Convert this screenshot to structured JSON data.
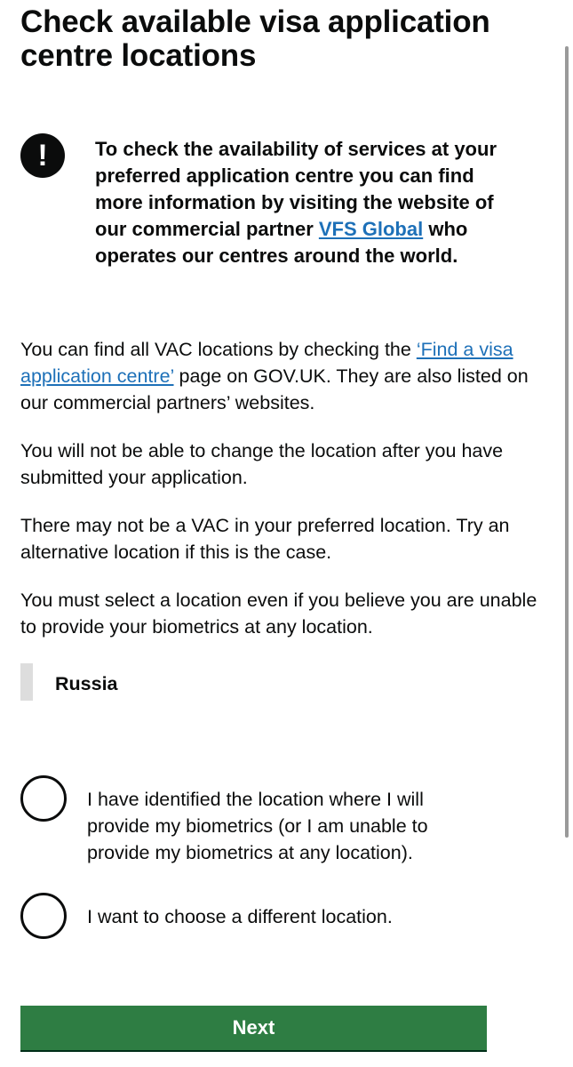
{
  "page": {
    "title": "Check available visa application centre locations"
  },
  "warning": {
    "icon": "exclamation-icon",
    "icon_glyph": "!",
    "text_before": "To check the availability of services at your preferred application centre you can find more information by visiting the website of our commercial partner ",
    "link_text": "VFS Global",
    "text_after": " who operates our centres around the world."
  },
  "content": {
    "p1_before": "You can find all VAC locations by checking the ",
    "p1_link": "‘Find a visa application centre’",
    "p1_after": " page on GOV.UK. They are also listed on our commercial partners’ websites.",
    "p2": "You will not be able to change the location after you have submitted your application.",
    "p3": "There may not be a VAC in your preferred location. Try an alternative location if this is the case.",
    "p4": "You must select a location even if you believe you are unable to provide your biometrics at any location."
  },
  "inset": {
    "location": "Russia"
  },
  "radios": [
    {
      "label": "I have identified the location where I will provide my biometrics (or I am unable to provide my biometrics at any location).",
      "checked": false
    },
    {
      "label": "I want to choose a different location.",
      "checked": false
    }
  ],
  "actions": {
    "next_label": "Next"
  },
  "colors": {
    "link": "#1d70b8",
    "button": "#2e7d43",
    "text": "#0b0c0c",
    "inset_bar": "#dddddd"
  }
}
